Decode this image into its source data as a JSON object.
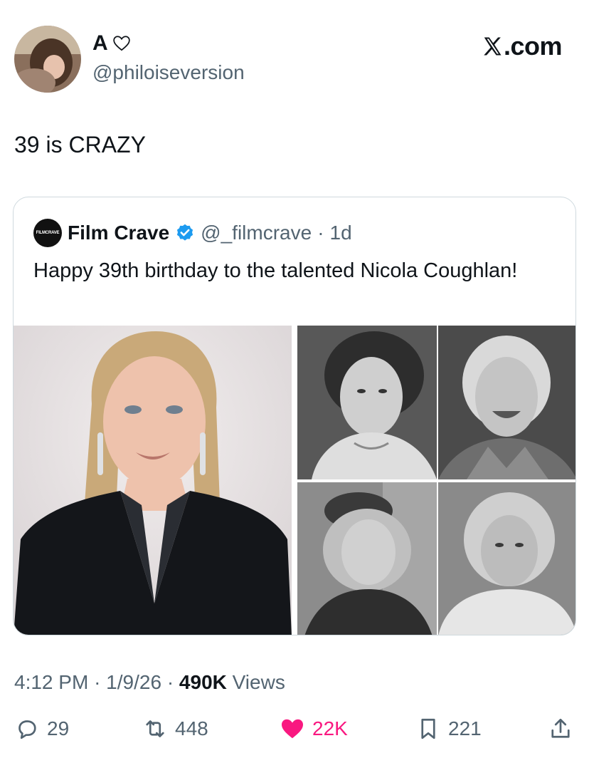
{
  "author": {
    "name": "A",
    "handle": "@philoiseversion"
  },
  "site": {
    "label": ".com"
  },
  "tweet": {
    "text": "39 is CRAZY"
  },
  "quoted": {
    "logo_text": "FILMCRAVE",
    "name": "Film Crave",
    "handle": "@_filmcrave",
    "separator": "·",
    "age": "1d",
    "text": "Happy 39th birthday to the talented Nicola Coughlan!"
  },
  "meta": {
    "time": "4:12 PM",
    "sep1": "·",
    "date": "1/9/26",
    "sep2": "·",
    "views_count": "490K",
    "views_label": "Views"
  },
  "actions": {
    "replies": "29",
    "reposts": "448",
    "likes": "22K",
    "bookmarks": "221"
  },
  "colors": {
    "like": "#f91880",
    "verified": "#1d9bf0",
    "secondary_text": "#536471"
  }
}
